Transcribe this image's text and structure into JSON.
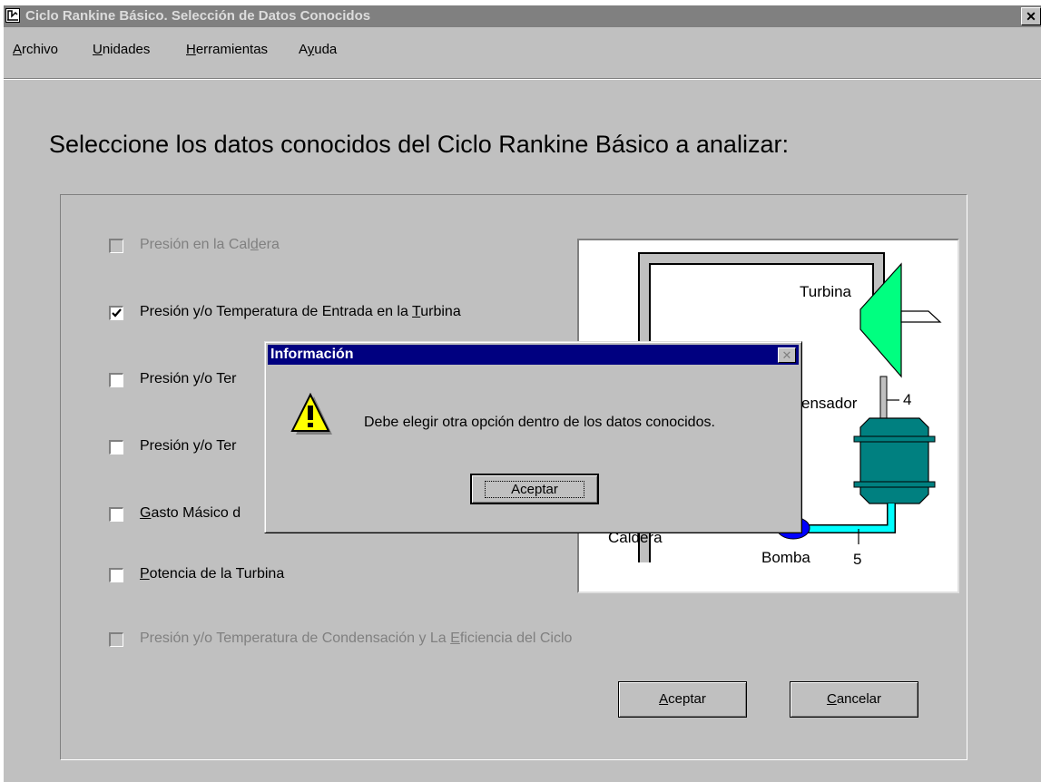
{
  "window": {
    "title": "Ciclo Rankine Básico.  Selección de Datos Conocidos",
    "close_glyph": "✕"
  },
  "menu": [
    {
      "label": "Archivo",
      "mnemonic": "A"
    },
    {
      "label": "Unidades",
      "mnemonic": "U"
    },
    {
      "label": "Herramientas",
      "mnemonic": "H"
    },
    {
      "label": "Ayuda",
      "mnemonic": "y"
    }
  ],
  "heading": "Seleccione los datos conocidos del Ciclo Rankine Básico a analizar:",
  "options": [
    {
      "label": "Presión en la Caldera",
      "checked": false,
      "enabled": false
    },
    {
      "label": "Presión y/o Temperatura de Entrada en la Turbina",
      "checked": true,
      "enabled": true
    },
    {
      "label": "Presión y/o Ter",
      "checked": false,
      "enabled": true
    },
    {
      "label": "Presión y/o Ter",
      "checked": false,
      "enabled": true
    },
    {
      "label": "Gasto Másico d",
      "checked": false,
      "enabled": true
    },
    {
      "label": "Potencia de la Turbina",
      "checked": false,
      "enabled": true
    },
    {
      "label": "Presión y/o Temperatura de Condensación y La Eficiencia del Ciclo",
      "checked": false,
      "enabled": false
    }
  ],
  "diagram": {
    "labels": {
      "turbina": "Turbina",
      "condensador": "ensador",
      "caldera": "Caldera",
      "bomba": "Bomba",
      "state4": "4",
      "state5": "5"
    },
    "colors": {
      "turbine": "#00ff80",
      "condenser": "#008080",
      "pipe_cyan": "#00ffff",
      "pump": "#0000ff",
      "boiler_pipe": "#c0c0c0"
    }
  },
  "buttons": {
    "accept": "Aceptar",
    "cancel": "Cancelar"
  },
  "dialog": {
    "title": "Información",
    "message": "Debe elegir otra opción dentro de los datos conocidos.",
    "ok_label": "Aceptar",
    "icon": "warning-icon"
  }
}
